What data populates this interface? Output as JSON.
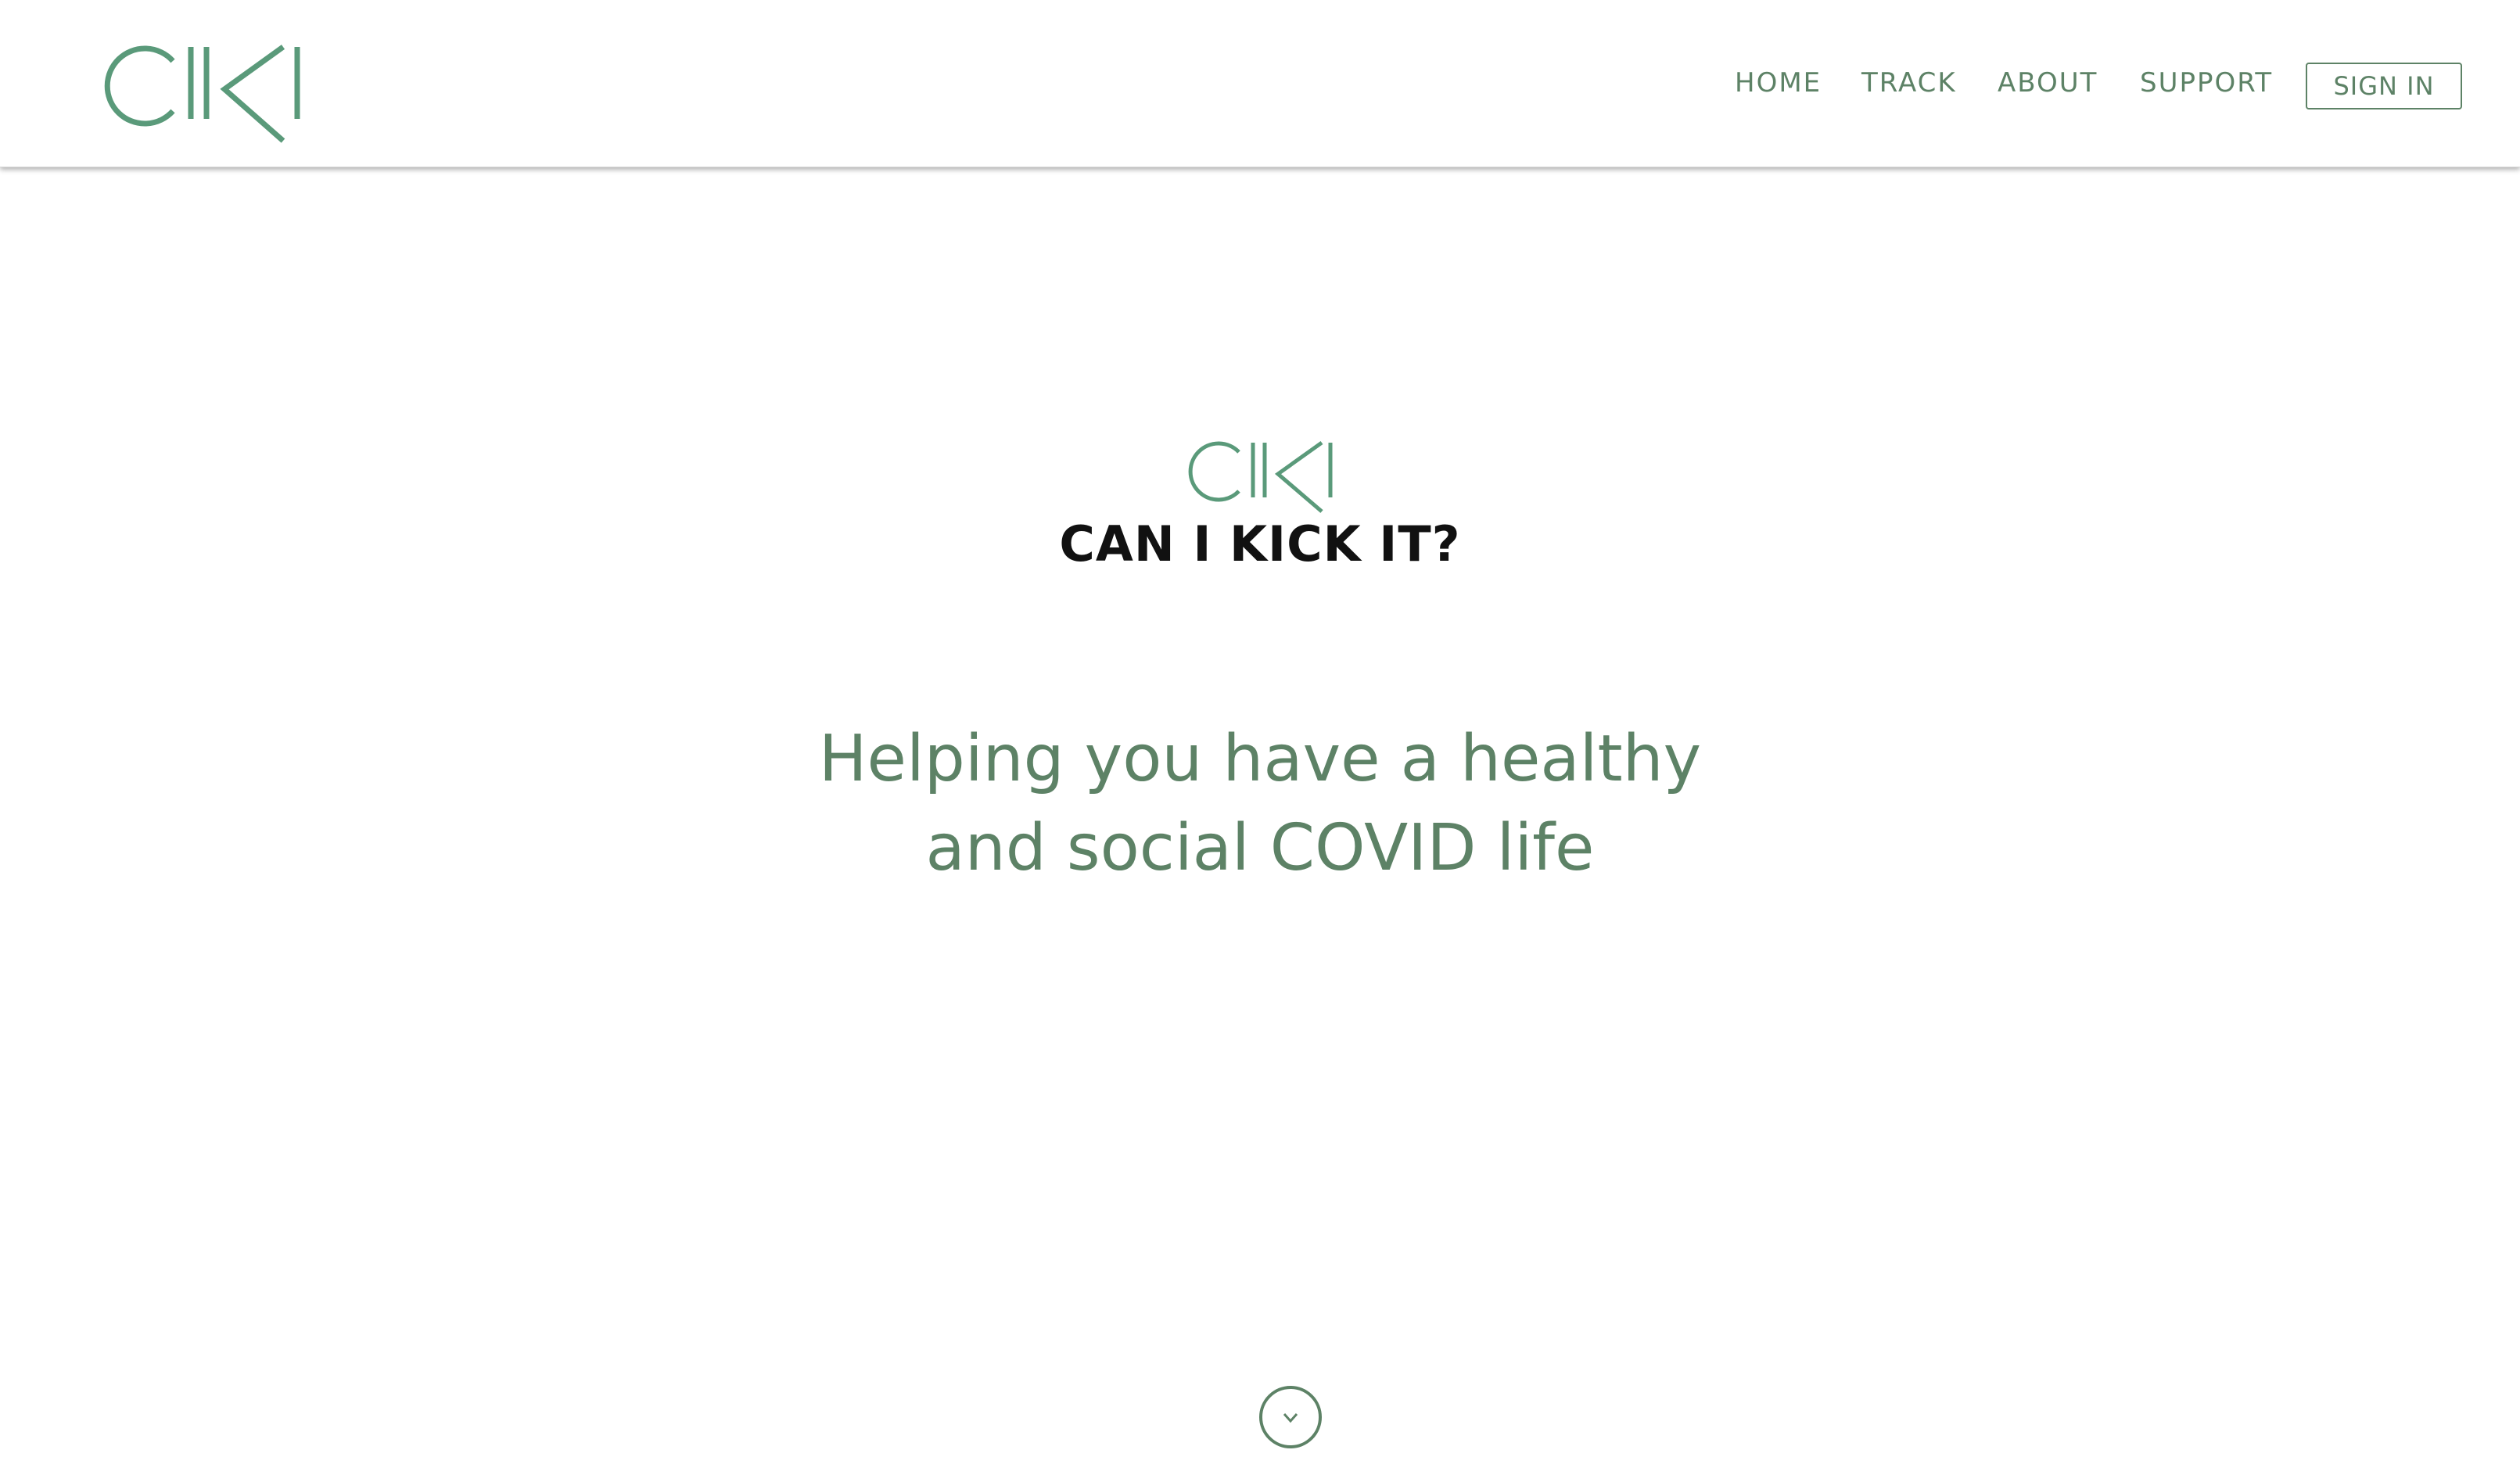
{
  "header": {
    "logo_icon": "ciki-logo-icon",
    "nav": {
      "home": "HOME",
      "track": "TRACK",
      "about": "ABOUT",
      "support": "SUPPORT"
    },
    "signin_label": "SIGN IN"
  },
  "hero": {
    "logo_icon": "ciki-logo-icon",
    "title": "CAN I KICK IT?",
    "tagline_line1": "Helping you have a healthy",
    "tagline_line2": "and social COVID life",
    "scroll_icon": "chevron-down-icon"
  },
  "colors": {
    "brand_green": "#5d8266",
    "logo_green": "#5a9a7a",
    "title_text": "#111111",
    "background": "#ffffff"
  }
}
